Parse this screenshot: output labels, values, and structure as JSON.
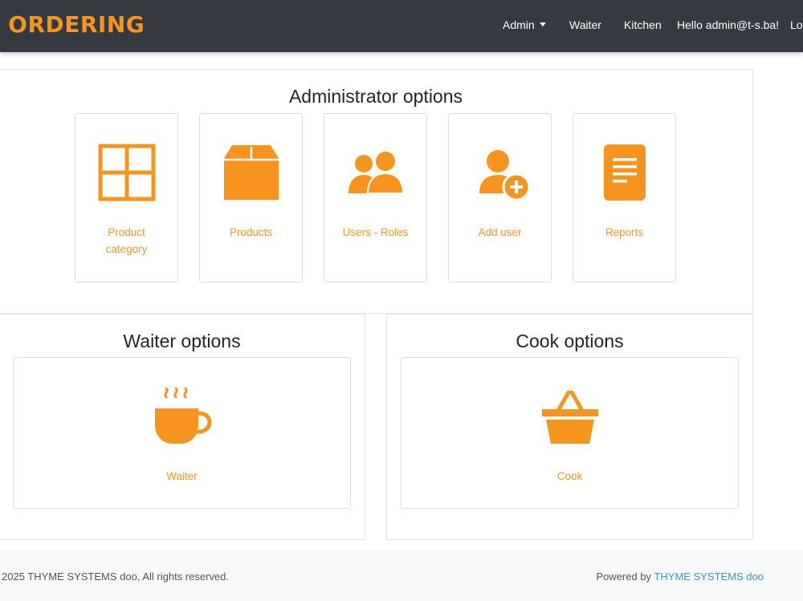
{
  "brand": {
    "text": "ORDERING"
  },
  "nav": {
    "admin": "Admin",
    "waiter": "Waiter",
    "kitchen": "Kitchen",
    "greeting": "Hello admin@t-s.ba!",
    "logout": "Lo"
  },
  "admin_panel": {
    "title": "Administrator options",
    "tiles": [
      {
        "label": "Product category",
        "icon": "grid-icon"
      },
      {
        "label": "Products",
        "icon": "box-icon"
      },
      {
        "label": "Users - Roles",
        "icon": "users-icon"
      },
      {
        "label": "Add user",
        "icon": "user-plus-icon"
      },
      {
        "label": "Reports",
        "icon": "document-icon"
      }
    ]
  },
  "waiter_panel": {
    "title": "Waiter options",
    "tile": {
      "label": "Waiter",
      "icon": "coffee-cup-icon"
    }
  },
  "cook_panel": {
    "title": "Cook options",
    "tile": {
      "label": "Cook",
      "icon": "basket-icon"
    }
  },
  "footer": {
    "copyright": "2025 THYME SYSTEMS doo, All rights reserved.",
    "powered_prefix": "Powered by",
    "powered_link": "THYME SYSTEMS doo"
  },
  "colors": {
    "accent": "#f7941d",
    "navbar": "#343a40",
    "link": "#3a96c3"
  }
}
